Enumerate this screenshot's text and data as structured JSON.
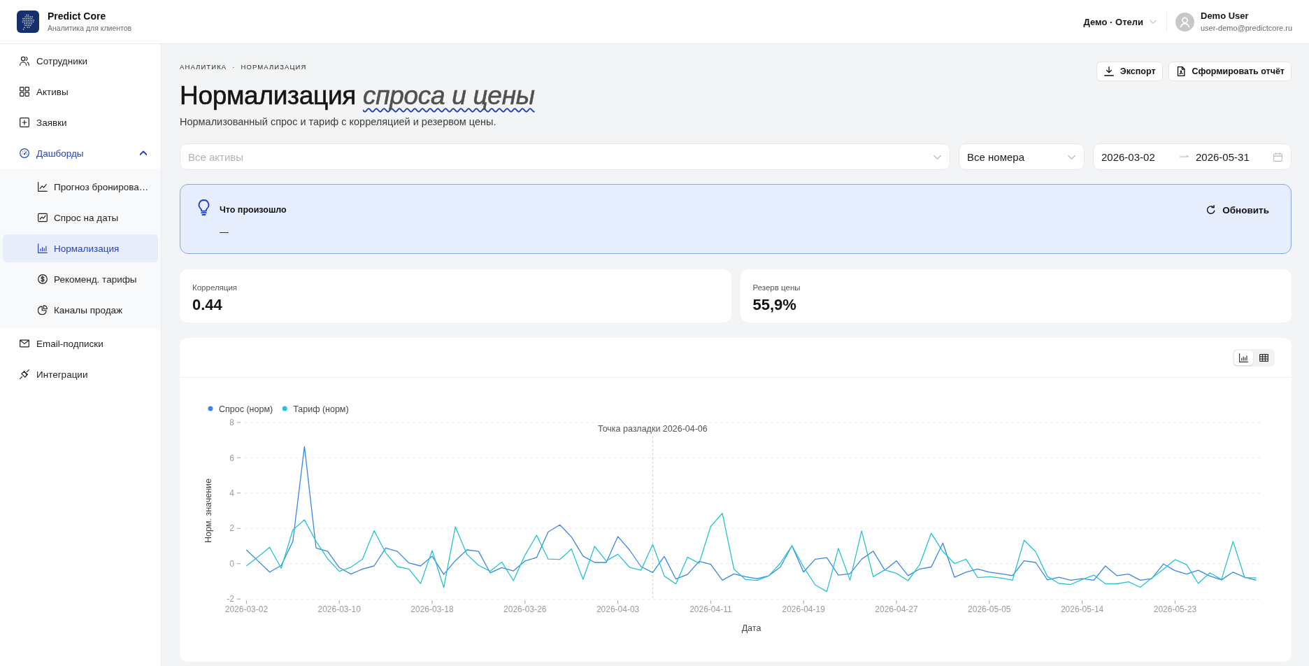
{
  "header": {
    "app_name": "Predict Core",
    "app_tagline": "Аналитика для клиентов",
    "workspace": "Демо · Отели",
    "user": {
      "name": "Demo User",
      "email": "user-demo@predictcore.ru"
    }
  },
  "sidebar": {
    "items": [
      {
        "label": "Сотрудники",
        "selected": false
      },
      {
        "label": "Активы",
        "selected": false
      },
      {
        "label": "Заявки",
        "selected": false
      },
      {
        "label": "Дашборды",
        "selected": true,
        "expanded": true,
        "children": [
          {
            "label": "Прогноз бронирова…",
            "selected": false
          },
          {
            "label": "Спрос на даты",
            "selected": false
          },
          {
            "label": "Нормализация",
            "selected": true
          },
          {
            "label": "Рекоменд. тарифы",
            "selected": false
          },
          {
            "label": "Каналы продаж",
            "selected": false
          }
        ]
      },
      {
        "label": "Email-подписки",
        "selected": false
      },
      {
        "label": "Интеграции",
        "selected": false
      }
    ]
  },
  "page": {
    "breadcrumb": {
      "items": [
        "АНАЛИТИКА",
        "НОРМАЛИЗАЦИЯ"
      ],
      "separator": "·"
    },
    "title": "Нормализация *спроса и цены*",
    "subtitle": "Нормализованный спрос и тариф с корреляцией и резервом цены.",
    "actions": [
      {
        "kind": "export",
        "label": "Экспорт"
      },
      {
        "kind": "report",
        "label": "Сформировать отчёт"
      }
    ]
  },
  "filters": {
    "asset": {
      "placeholder": "Все активы"
    },
    "rooms": {
      "value": "Все номера"
    },
    "date_range": {
      "start": "2026-03-02",
      "end": "2026-05-31"
    }
  },
  "insight": {
    "title": "Что произошло",
    "body": "—",
    "action": "Обновить"
  },
  "kpis": [
    {
      "label": "Корреляция",
      "value": "0.44"
    },
    {
      "label": "Резерв цены",
      "value": "55,9%"
    }
  ],
  "chart_panel": {
    "view_toggle": [
      {
        "kind": "chart",
        "selected": true
      },
      {
        "kind": "table",
        "selected": false
      }
    ],
    "chart_data": {
      "type": "line",
      "xlabel": "Дата",
      "ylabel": "Норм. значение",
      "legend": "top-left",
      "grid": true,
      "categories": [
        "2026-03-02",
        null,
        null,
        null,
        null,
        null,
        null,
        null,
        "2026-03-10",
        null,
        null,
        null,
        null,
        null,
        null,
        null,
        "2026-03-18",
        null,
        null,
        null,
        null,
        null,
        null,
        null,
        "2026-03-26",
        null,
        null,
        null,
        null,
        null,
        null,
        null,
        "2026-04-03",
        null,
        null,
        null,
        null,
        null,
        null,
        null,
        "2026-04-11",
        null,
        null,
        null,
        null,
        null,
        null,
        null,
        "2026-04-19",
        null,
        null,
        null,
        null,
        null,
        null,
        null,
        "2026-04-27",
        null,
        null,
        null,
        null,
        null,
        null,
        null,
        "2026-05-05",
        null,
        null,
        null,
        null,
        null,
        null,
        null,
        "2026-05-14",
        null,
        null,
        null,
        null,
        null,
        null,
        null,
        "2026-05-23",
        null,
        null,
        null,
        null,
        null,
        null,
        null
      ],
      "series": [
        {
          "name": "Спрос (норм)",
          "color": "#3a86e8",
          "values": [
            0.78,
            0.15,
            -0.48,
            -0.1,
            1.26,
            6.63,
            0.89,
            0.7,
            -0.22,
            -0.59,
            -0.3,
            -0.13,
            0.89,
            0.7,
            0.04,
            -0.13,
            0.43,
            -0.61,
            0.17,
            0.78,
            0.7,
            -0.52,
            -0.22,
            -0.41,
            0.15,
            0.35,
            1.8,
            2.2,
            1.52,
            0.43,
            0.07,
            0.07,
            1.54,
            0.78,
            -0.17,
            -0.5,
            0.41,
            -0.87,
            -0.61,
            0.13,
            -0.04,
            -0.94,
            -0.58,
            -0.74,
            -0.85,
            -0.69,
            -0.19,
            1.02,
            -0.48,
            0.25,
            0.34,
            -0.65,
            -0.57,
            0.25,
            0.71,
            -0.37,
            0.16,
            -0.68,
            -0.3,
            -0.19,
            1.17,
            -0.77,
            -0.48,
            -0.3,
            -0.48,
            -0.57,
            -0.68,
            0.16,
            0.07,
            -0.92,
            -0.77,
            -0.94,
            -0.85,
            -0.94,
            -0.13,
            -0.68,
            -0.59,
            -0.94,
            -0.85,
            -0.02,
            -0.39,
            -0.59,
            -0.37,
            -0.7,
            -0.92,
            -0.48,
            -0.77,
            -0.94
          ]
        },
        {
          "name": "Тариф (норм)",
          "color": "#25c4cf",
          "values": [
            -0.13,
            0.39,
            0.93,
            -0.26,
            1.91,
            2.48,
            1.26,
            0.28,
            -0.43,
            -0.2,
            0.26,
            1.87,
            0.61,
            -0.17,
            -0.3,
            -1.13,
            0.74,
            -1.35,
            2.09,
            0.52,
            -0.09,
            -0.43,
            0.09,
            -0.96,
            0.48,
            1.61,
            0.26,
            0.24,
            0.83,
            -0.89,
            0.98,
            0.15,
            0.54,
            -0.2,
            -0.37,
            1.09,
            -0.7,
            -1.15,
            0.37,
            0.02,
            2.11,
            2.85,
            -0.31,
            -0.9,
            -0.95,
            -0.69,
            0.03,
            1.02,
            -0.19,
            -1.2,
            -1.58,
            0.87,
            -0.94,
            1.86,
            -0.74,
            -0.35,
            -0.55,
            -0.96,
            -0.06,
            1.72,
            0.69,
            0.01,
            0.25,
            -0.79,
            -0.74,
            -0.81,
            -0.94,
            1.33,
            0.67,
            -0.72,
            -1.12,
            -1.18,
            -0.9,
            -0.65,
            -1.14,
            -1.14,
            -1.03,
            -1.34,
            -0.81,
            -0.32,
            0.23,
            -0.06,
            -1.12,
            -0.52,
            -0.9,
            1.26,
            -0.79,
            -0.81
          ]
        }
      ],
      "ylim": [
        -2,
        8
      ],
      "yticks": [
        -2,
        0,
        2,
        4,
        6,
        8
      ],
      "ref_lines": [
        {
          "axis": "x",
          "label": "Точка разладки 2026-04-06"
        }
      ]
    }
  }
}
